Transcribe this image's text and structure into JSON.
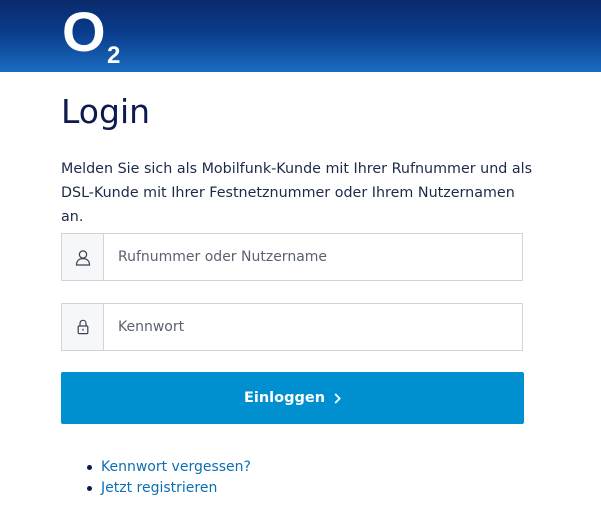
{
  "header": {
    "logo_main": "O",
    "logo_sub": "2",
    "brand_color": "#0a3c8c"
  },
  "page": {
    "title": "Login",
    "intro": "Melden Sie sich als Mobilfunk-Kunde mit Ihrer Rufnummer und als DSL-Kunde mit Ihrer Festnetznummer oder Ihrem Nutzernamen an."
  },
  "form": {
    "username": {
      "placeholder": "Rufnummer oder Nutzername",
      "value": "",
      "icon": "user-icon"
    },
    "password": {
      "placeholder": "Kennwort",
      "value": "",
      "icon": "lock-icon"
    },
    "submit_label": "Einloggen",
    "submit_color": "#0090d0"
  },
  "links": [
    {
      "label": "Kennwort vergessen?"
    },
    {
      "label": "Jetzt registrieren"
    }
  ]
}
